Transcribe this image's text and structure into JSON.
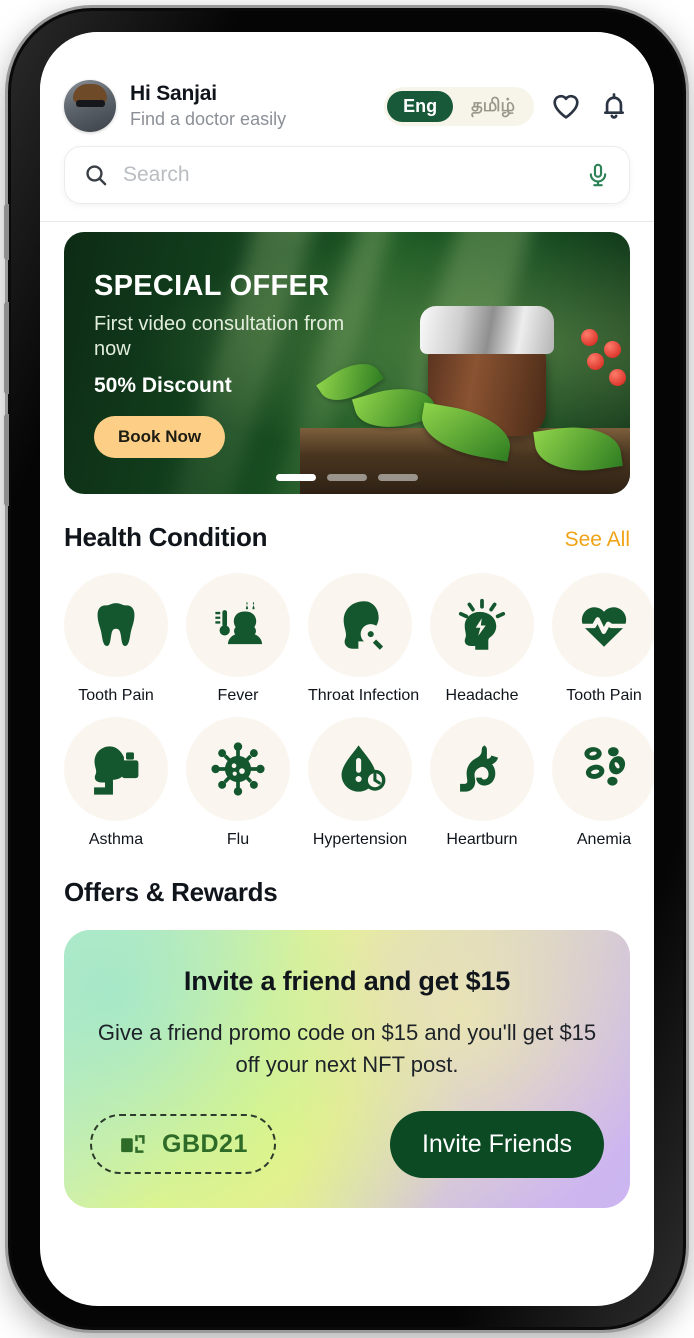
{
  "header": {
    "greeting_name": "Hi Sanjai",
    "greeting_sub": "Find a doctor easily",
    "avatar_icon": "user-avatar",
    "languages": [
      {
        "label": "Eng",
        "active": true
      },
      {
        "label": "தமிழ்",
        "active": false
      }
    ],
    "favorites_icon": "heart-icon",
    "notifications_icon": "bell-icon"
  },
  "search": {
    "placeholder": "Search",
    "value": "",
    "search_icon": "search-icon",
    "mic_icon": "microphone-icon"
  },
  "banner": {
    "title": "SPECIAL OFFER",
    "subtitle": "First video consultation from now",
    "discount": "50% Discount",
    "cta_label": "Book Now",
    "dots_total": 3,
    "active_dot": 1,
    "accent_color": "#fcce86"
  },
  "health_condition": {
    "section_title": "Health Condition",
    "see_all_label": "See All",
    "see_all_color": "#f0a316",
    "rows": [
      [
        {
          "label": "Tooth Pain",
          "icon": "tooth-icon"
        },
        {
          "label": "Fever",
          "icon": "fever-thermometer-icon"
        },
        {
          "label": "Throat Infection",
          "icon": "throat-infection-icon"
        },
        {
          "label": "Headache",
          "icon": "headache-icon"
        },
        {
          "label": "Tooth Pain",
          "icon": "heartbeat-icon"
        }
      ],
      [
        {
          "label": "Asthma",
          "icon": "asthma-inhaler-icon"
        },
        {
          "label": "Flu",
          "icon": "virus-icon"
        },
        {
          "label": "Hypertension",
          "icon": "blood-pressure-drop-icon"
        },
        {
          "label": "Heartburn",
          "icon": "stomach-icon"
        },
        {
          "label": "Anemia",
          "icon": "blood-cells-icon"
        }
      ]
    ],
    "icon_color": "#14572f",
    "circle_color": "#faf6ef"
  },
  "offers": {
    "section_title": "Offers & Rewards",
    "referral": {
      "title": "Invite a friend and get $15",
      "description": "Give a friend promo code on $15 and you'll get $15 off your next NFT post.",
      "promo_code": "GBD21",
      "copy_icon": "copy-icon",
      "invite_label": "Invite Friends",
      "invite_color": "#0c4a23"
    }
  }
}
